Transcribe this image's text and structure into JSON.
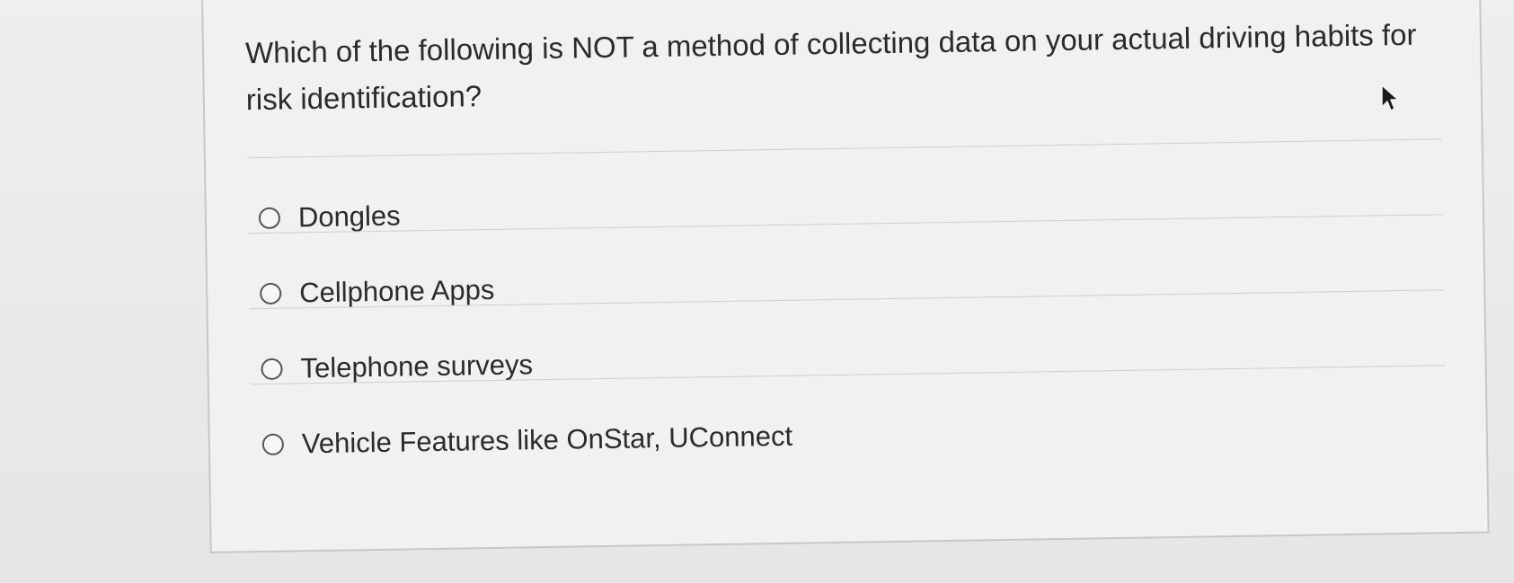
{
  "question": {
    "text": "Which of the following is NOT a method of collecting data on your actual driving habits for risk identification?"
  },
  "options": [
    {
      "label": "Dongles",
      "selected": false
    },
    {
      "label": "Cellphone Apps",
      "selected": false
    },
    {
      "label": "Telephone surveys",
      "selected": false
    },
    {
      "label": "Vehicle Features like OnStar, UConnect",
      "selected": false
    }
  ],
  "cursor": {
    "icon": "arrow-pointer-icon"
  }
}
